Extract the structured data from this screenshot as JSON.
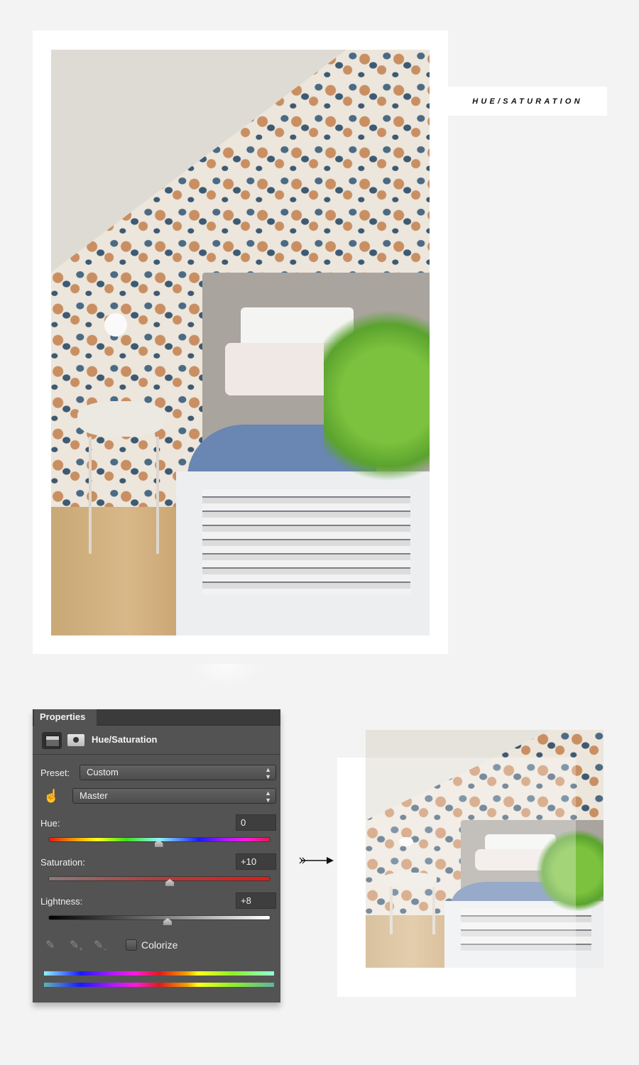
{
  "header_label": "HUE/SATURATION",
  "main_photo": {
    "description": "Bedroom with floral wallpaper, grey upholstered bed, blue throw, nightstand, plant and book stack"
  },
  "properties_panel": {
    "tab_label": "Properties",
    "adjustment_icon": "hue-saturation-adjustment-icon",
    "mask_icon": "layer-mask-icon",
    "title": "Hue/Saturation",
    "preset_label": "Preset:",
    "preset_value": "Custom",
    "channel_value": "Master",
    "targeted_adjustment_icon": "hand-adjust-icon",
    "sliders": [
      {
        "label": "Hue:",
        "value": "0",
        "position_fraction": 0.5
      },
      {
        "label": "Saturation:",
        "value": "+10",
        "position_fraction": 0.55
      },
      {
        "label": "Lightness:",
        "value": "+8",
        "position_fraction": 0.54
      }
    ],
    "eyedroppers": [
      "eyedropper-icon",
      "eyedropper-add-icon",
      "eyedropper-subtract-icon"
    ],
    "colorize_label": "Colorize",
    "colorize_checked": false
  },
  "arrow_icon": "arrow-right-icon",
  "result_photo": {
    "description": "Adjusted bedroom photo after Hue/Saturation"
  }
}
